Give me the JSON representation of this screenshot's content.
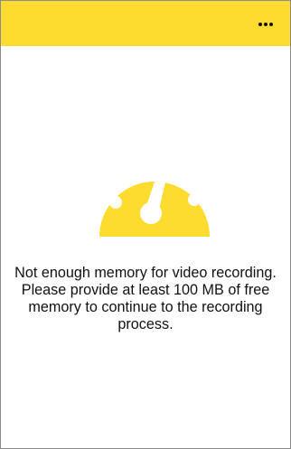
{
  "app_bar": {
    "menu_icon": "more-horizontal-icon",
    "background_color": "#FDDC2F"
  },
  "status": {
    "icon": "speedometer-gauge-icon",
    "message": "Not enough memory for video recording. Please provide at least 100 MB of free memory to continue to the recording process."
  }
}
